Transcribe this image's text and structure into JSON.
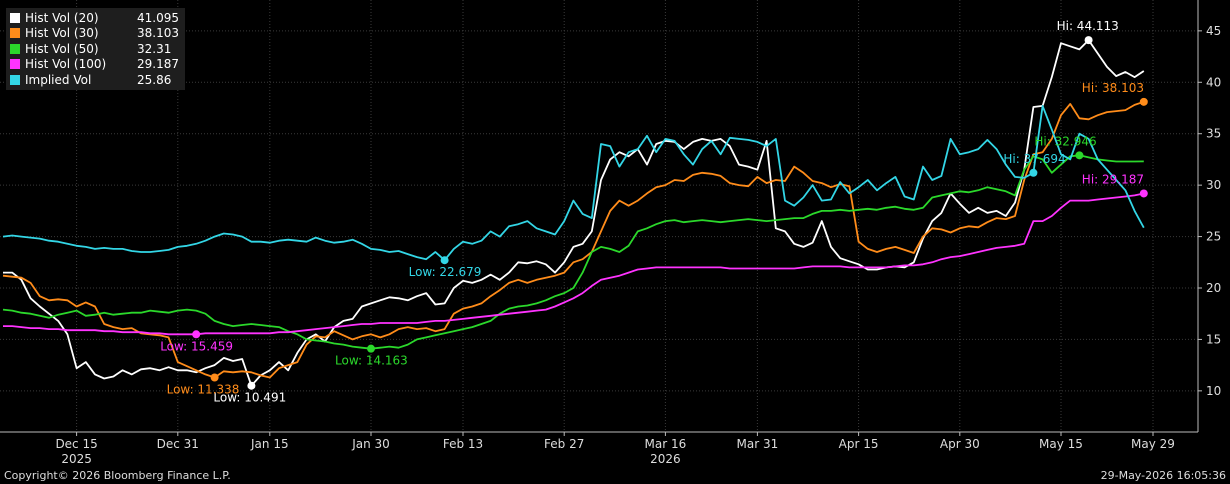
{
  "chart_data": {
    "type": "line",
    "ylim": [
      6,
      48
    ],
    "yticks": [
      10,
      15,
      20,
      25,
      30,
      35,
      40,
      45
    ],
    "x_count": 121,
    "xticks": [
      {
        "i": 8,
        "label": "Dec 15"
      },
      {
        "i": 19,
        "label": "Dec 31"
      },
      {
        "i": 29,
        "label": "Jan 15"
      },
      {
        "i": 40,
        "label": "Jan 30"
      },
      {
        "i": 50,
        "label": "Feb 13"
      },
      {
        "i": 61,
        "label": "Feb 27"
      },
      {
        "i": 72,
        "label": "Mar 16"
      },
      {
        "i": 82,
        "label": "Mar 31"
      },
      {
        "i": 93,
        "label": "Apr 15"
      },
      {
        "i": 104,
        "label": "Apr 30"
      },
      {
        "i": 115,
        "label": "May 15"
      },
      {
        "i": 125,
        "label": "May 29"
      }
    ],
    "year_labels": [
      {
        "i": 8,
        "label": "2025"
      },
      {
        "i": 72,
        "label": "2026"
      }
    ],
    "series": [
      {
        "name": "Hist Vol (20)",
        "value": "41.095",
        "color": "#ffffff",
        "values": [
          21.5,
          21.5,
          20.8,
          19.0,
          18.2,
          17.5,
          16.8,
          15.5,
          12.2,
          12.8,
          11.6,
          11.2,
          11.4,
          12.0,
          11.6,
          12.1,
          12.2,
          12.0,
          12.3,
          12.0,
          12.0,
          11.8,
          12.2,
          12.5,
          13.2,
          12.9,
          13.1,
          10.5,
          11.5,
          12.0,
          12.8,
          12.0,
          13.7,
          15.0,
          15.5,
          14.8,
          16.2,
          16.8,
          17.0,
          18.2,
          18.5,
          18.8,
          19.1,
          19.0,
          18.8,
          19.2,
          19.5,
          18.4,
          18.5,
          20.0,
          20.7,
          20.5,
          20.8,
          21.3,
          20.8,
          21.5,
          22.5,
          22.4,
          22.6,
          22.3,
          21.5,
          22.5,
          24.0,
          24.3,
          25.5,
          30.5,
          32.5,
          33.2,
          32.8,
          33.5,
          32.0,
          34.0,
          34.3,
          34.2,
          33.5,
          34.2,
          34.5,
          34.3,
          34.5,
          33.8,
          32.0,
          31.8,
          31.5,
          34.3,
          25.8,
          25.5,
          24.3,
          24.0,
          24.4,
          26.5,
          24.0,
          22.9,
          22.6,
          22.3,
          21.8,
          21.8,
          22.0,
          22.1,
          22.0,
          22.5,
          24.8,
          26.5,
          27.3,
          29.2,
          28.2,
          27.3,
          27.8,
          27.3,
          27.5,
          27.0,
          28.3,
          31.5,
          37.6,
          37.7,
          40.5,
          43.8,
          43.5,
          43.2,
          44.1,
          42.8,
          41.5,
          40.6,
          41.0,
          40.5,
          41.1
        ]
      },
      {
        "name": "Hist Vol (30)",
        "value": "38.103",
        "color": "#ff8c1a",
        "values": [
          21.2,
          21.1,
          21.0,
          20.5,
          19.2,
          18.8,
          18.9,
          18.8,
          18.2,
          18.6,
          18.2,
          16.5,
          16.2,
          16.0,
          16.1,
          15.6,
          15.5,
          15.4,
          15.2,
          12.8,
          12.4,
          12.0,
          11.6,
          11.3,
          11.9,
          11.8,
          11.9,
          11.8,
          11.5,
          11.3,
          12.2,
          12.5,
          12.8,
          14.5,
          15.3,
          15.2,
          15.8,
          15.4,
          15.0,
          15.3,
          15.5,
          15.2,
          15.5,
          16.0,
          16.2,
          16.0,
          16.1,
          15.8,
          16.0,
          17.5,
          18.0,
          18.2,
          18.5,
          19.2,
          19.8,
          20.5,
          20.8,
          20.5,
          20.8,
          21.0,
          21.2,
          21.5,
          22.5,
          22.8,
          23.5,
          25.5,
          27.5,
          28.5,
          28.0,
          28.5,
          29.2,
          29.8,
          30.0,
          30.5,
          30.4,
          31.0,
          31.2,
          31.1,
          30.9,
          30.2,
          30.0,
          29.9,
          30.8,
          30.2,
          30.5,
          30.4,
          31.8,
          31.2,
          30.4,
          30.2,
          29.8,
          30.1,
          29.9,
          24.5,
          23.8,
          23.5,
          23.8,
          24.0,
          23.7,
          23.4,
          25.0,
          25.8,
          25.7,
          25.4,
          25.8,
          26.0,
          25.9,
          26.4,
          26.8,
          26.7,
          27.0,
          30.5,
          33.0,
          33.2,
          34.5,
          36.8,
          37.9,
          36.5,
          36.4,
          36.8,
          37.1,
          37.2,
          37.3,
          37.8,
          38.1
        ]
      },
      {
        "name": "Hist Vol (50)",
        "value": "32.31",
        "color": "#2bd82b",
        "values": [
          17.9,
          17.8,
          17.6,
          17.5,
          17.3,
          17.1,
          17.4,
          17.6,
          17.8,
          17.3,
          17.4,
          17.6,
          17.4,
          17.5,
          17.6,
          17.6,
          17.8,
          17.7,
          17.6,
          17.8,
          17.9,
          17.8,
          17.5,
          16.8,
          16.5,
          16.3,
          16.4,
          16.5,
          16.4,
          16.3,
          16.2,
          15.8,
          15.5,
          15.0,
          14.9,
          14.8,
          14.6,
          14.5,
          14.3,
          14.2,
          14.1,
          14.2,
          14.3,
          14.2,
          14.5,
          15.0,
          15.2,
          15.4,
          15.6,
          15.8,
          16.0,
          16.2,
          16.5,
          16.8,
          17.5,
          18.0,
          18.2,
          18.3,
          18.5,
          18.8,
          19.2,
          19.5,
          20.0,
          21.5,
          23.5,
          24.0,
          23.8,
          23.5,
          24.1,
          25.5,
          25.8,
          26.2,
          26.5,
          26.6,
          26.4,
          26.5,
          26.6,
          26.5,
          26.4,
          26.5,
          26.6,
          26.7,
          26.6,
          26.5,
          26.6,
          26.7,
          26.8,
          26.8,
          27.2,
          27.5,
          27.5,
          27.6,
          27.5,
          27.6,
          27.7,
          27.6,
          27.8,
          27.9,
          27.7,
          27.6,
          27.8,
          28.8,
          29.0,
          29.2,
          29.4,
          29.3,
          29.5,
          29.8,
          29.6,
          29.4,
          29.0,
          31.5,
          32.8,
          32.5,
          31.2,
          32.0,
          32.8,
          32.9,
          32.7,
          32.5,
          32.4,
          32.3,
          32.3,
          32.3,
          32.31
        ]
      },
      {
        "name": "Hist Vol (100)",
        "value": "29.187",
        "color": "#ff33ff",
        "values": [
          16.3,
          16.3,
          16.2,
          16.1,
          16.1,
          16.0,
          16.0,
          15.9,
          15.9,
          15.9,
          15.9,
          15.8,
          15.8,
          15.7,
          15.7,
          15.7,
          15.6,
          15.6,
          15.5,
          15.5,
          15.5,
          15.5,
          15.6,
          15.6,
          15.6,
          15.6,
          15.6,
          15.6,
          15.6,
          15.6,
          15.7,
          15.7,
          15.8,
          15.9,
          16.0,
          16.1,
          16.2,
          16.3,
          16.4,
          16.5,
          16.5,
          16.6,
          16.6,
          16.6,
          16.6,
          16.6,
          16.7,
          16.8,
          16.8,
          16.9,
          17.0,
          17.1,
          17.2,
          17.3,
          17.4,
          17.5,
          17.6,
          17.7,
          17.8,
          17.9,
          18.2,
          18.6,
          19.0,
          19.5,
          20.2,
          20.8,
          21.0,
          21.2,
          21.5,
          21.8,
          21.9,
          22.0,
          22.0,
          22.0,
          22.0,
          22.0,
          22.0,
          22.0,
          22.0,
          21.9,
          21.9,
          21.9,
          21.9,
          21.9,
          21.9,
          21.9,
          21.9,
          22.0,
          22.1,
          22.1,
          22.1,
          22.1,
          22.0,
          22.0,
          22.0,
          22.0,
          22.0,
          22.1,
          22.2,
          22.2,
          22.3,
          22.5,
          22.8,
          23.0,
          23.1,
          23.3,
          23.5,
          23.7,
          23.9,
          24.0,
          24.1,
          24.3,
          26.5,
          26.5,
          27.0,
          27.8,
          28.5,
          28.5,
          28.5,
          28.6,
          28.7,
          28.8,
          28.9,
          29.0,
          29.19
        ]
      },
      {
        "name": "Implied Vol",
        "value": "25.86",
        "color": "#33d6e6",
        "values": [
          25.0,
          25.1,
          25.0,
          24.9,
          24.8,
          24.6,
          24.5,
          24.3,
          24.1,
          24.0,
          23.8,
          23.9,
          23.8,
          23.8,
          23.6,
          23.5,
          23.5,
          23.6,
          23.7,
          24.0,
          24.1,
          24.3,
          24.6,
          25.0,
          25.3,
          25.2,
          25.0,
          24.5,
          24.5,
          24.4,
          24.6,
          24.7,
          24.6,
          24.5,
          24.9,
          24.6,
          24.4,
          24.5,
          24.7,
          24.3,
          23.8,
          23.7,
          23.5,
          23.6,
          23.3,
          23.0,
          22.8,
          23.5,
          22.7,
          23.8,
          24.5,
          24.3,
          24.6,
          25.5,
          25.0,
          26.0,
          26.2,
          26.5,
          25.8,
          25.5,
          25.2,
          26.5,
          28.5,
          27.2,
          26.8,
          34.0,
          33.8,
          31.8,
          33.2,
          33.5,
          34.8,
          33.2,
          34.5,
          34.3,
          33.0,
          32.0,
          33.5,
          34.3,
          33.0,
          34.6,
          34.5,
          34.4,
          34.2,
          33.8,
          34.5,
          28.5,
          28.0,
          28.8,
          30.0,
          28.5,
          28.6,
          30.3,
          29.2,
          29.8,
          30.5,
          29.5,
          30.2,
          30.8,
          28.9,
          28.6,
          31.8,
          30.5,
          30.9,
          34.5,
          33.0,
          33.2,
          33.5,
          34.4,
          33.5,
          32.0,
          30.8,
          30.7,
          31.2,
          37.7,
          35.4,
          33.0,
          32.5,
          35.0,
          34.5,
          32.5,
          31.5,
          30.5,
          29.5,
          27.5,
          25.86
        ]
      }
    ],
    "annotations": [
      {
        "label": "Hi: 44.113",
        "series": 0,
        "i": 118,
        "color": "#ffffff",
        "dx": -32,
        "dy": -10
      },
      {
        "label": "Low: 10.491",
        "series": 0,
        "i": 27,
        "color": "#ffffff",
        "dx": -38,
        "dy": 16
      },
      {
        "label": "Hi: 38.103",
        "series": 1,
        "i": 126,
        "color": "#ff8c1a",
        "dx": -62,
        "dy": -10
      },
      {
        "label": "Low: 11.338",
        "series": 1,
        "i": 23,
        "color": "#ff8c1a",
        "dx": -48,
        "dy": 16
      },
      {
        "label": "Hi: 32.946",
        "series": 2,
        "i": 117,
        "color": "#2bd82b",
        "dx": -45,
        "dy": -10
      },
      {
        "label": "Low: 14.163",
        "series": 2,
        "i": 40,
        "color": "#2bd82b",
        "dx": -36,
        "dy": 16
      },
      {
        "label": "Hi: 29.187",
        "series": 3,
        "i": 126,
        "color": "#ff33ff",
        "dx": -62,
        "dy": -10
      },
      {
        "label": "Low: 15.459",
        "series": 3,
        "i": 21,
        "color": "#ff33ff",
        "dx": -36,
        "dy": 16
      },
      {
        "label": "Hi: 37.694",
        "series": 4,
        "i": 112,
        "color": "#33d6e6",
        "dx": -30,
        "dy": -10
      },
      {
        "label": "Low: 22.679",
        "series": 4,
        "i": 48,
        "color": "#33d6e6",
        "dx": -36,
        "dy": 16
      }
    ]
  },
  "footer": {
    "copyright": "Copyright© 2026 Bloomberg Finance L.P.",
    "timestamp": "29-May-2026 16:05:36"
  }
}
